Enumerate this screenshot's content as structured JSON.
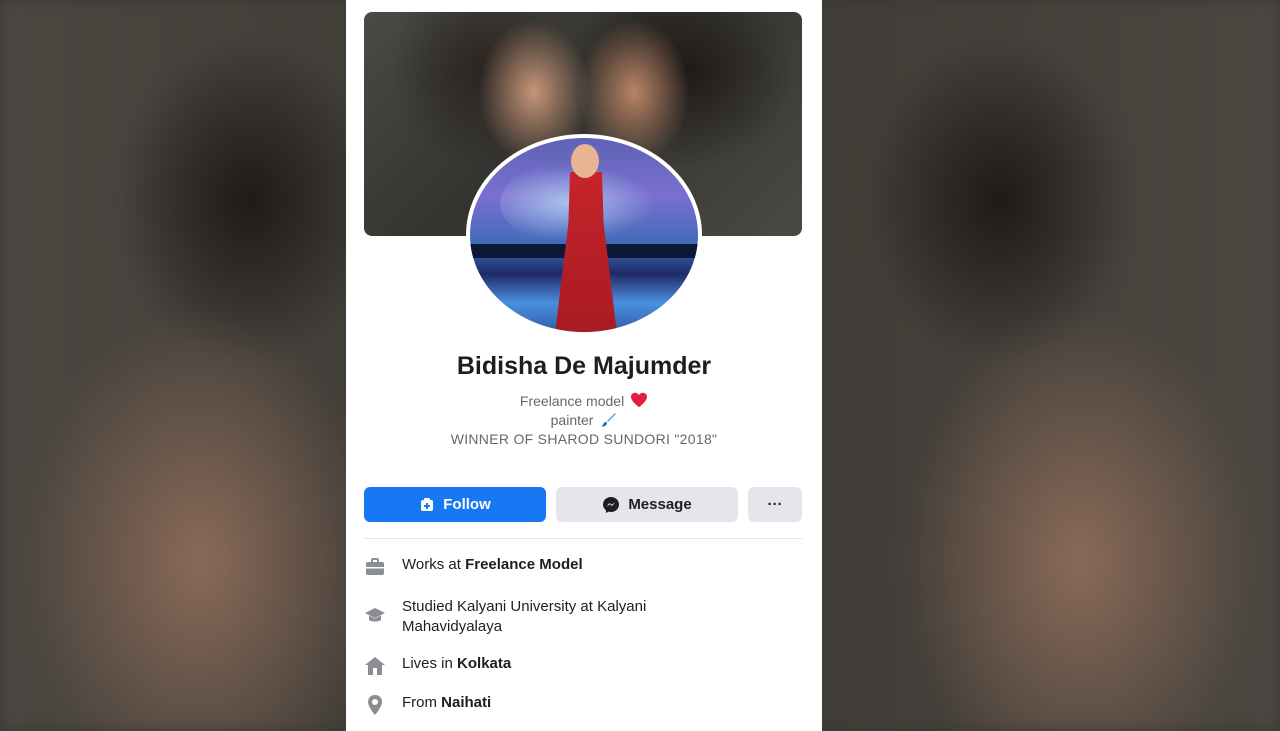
{
  "profile": {
    "name": "Bidisha De Majumder",
    "bio_line1": "Freelance model",
    "bio_line2": "painter",
    "bio_line3": "WINNER OF SHAROD SUNDORI \"2018\""
  },
  "actions": {
    "follow_label": "Follow",
    "message_label": "Message",
    "more_label": "···"
  },
  "intro": {
    "work_prefix": "Works at",
    "work_place": "Freelance Model",
    "study_text": "Studied Kalyani University at Kalyani",
    "study_text2": "Mahavidyalaya",
    "lives_prefix": "Lives in",
    "lives_place": "Kolkata",
    "from_prefix": "From",
    "from_place": "Naihati"
  },
  "colors": {
    "accent": "#1877f2",
    "secondary_button": "#e4e6eb",
    "heart": "#e41e3f"
  },
  "icons": {
    "follow": "follow-plus-icon",
    "message": "messenger-icon",
    "work": "briefcase-icon",
    "study": "graduation-cap-icon",
    "live": "home-icon",
    "from": "location-pin-icon"
  }
}
